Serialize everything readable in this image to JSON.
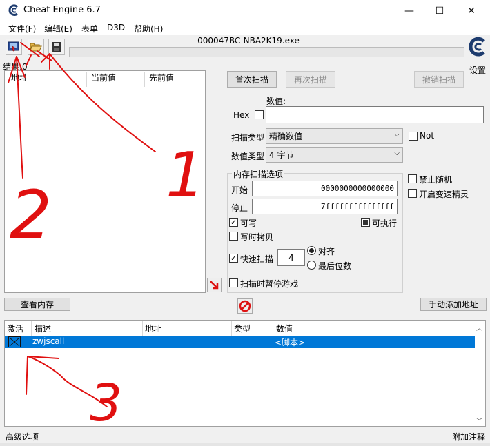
{
  "window": {
    "title": "Cheat Engine 6.7",
    "minimize": "—",
    "maximize": "☐",
    "close": "✕"
  },
  "menu": [
    "文件(F)",
    "编辑(E)",
    "表单",
    "D3D",
    "帮助(H)"
  ],
  "toolbar": {
    "process_name": "000047BC-NBA2K19.exe",
    "settings_label": "设置",
    "icons": [
      "select-process-icon",
      "open-folder-icon",
      "save-disk-icon"
    ]
  },
  "results": {
    "label": "结果:0",
    "columns": [
      "地址",
      "当前值",
      "先前值"
    ]
  },
  "scan": {
    "first_scan": "首次扫描",
    "next_scan": "再次扫描",
    "undo_scan": "撤销扫描",
    "value_label": "数值:",
    "hex_label": "Hex",
    "value": "",
    "scan_type_label": "扫描类型",
    "scan_type_value": "精确数值",
    "not_label": "Not",
    "value_type_label": "数值类型",
    "value_type_value": "4 字节"
  },
  "memory_options": {
    "title": "内存扫描选项",
    "start_label": "开始",
    "start_value": "0000000000000000",
    "stop_label": "停止",
    "stop_value": "7fffffffffffffff",
    "writable_label": "可写",
    "writable": true,
    "executable_label": "可执行",
    "copy_on_write_label": "写时拷贝",
    "fast_scan_label": "快速扫描",
    "fast_scan_value": "4",
    "align_label": "对齐",
    "last_digits_label": "最后位数",
    "pause_label": "扫描时暂停游戏"
  },
  "side_options": {
    "no_random_label": "禁止随机",
    "speedhack_label": "开启变速精灵"
  },
  "buttons": {
    "view_memory": "查看内存",
    "add_address": "手动添加地址"
  },
  "address_list": {
    "columns": [
      "激活",
      "描述",
      "地址",
      "类型",
      "数值"
    ],
    "rows": [
      {
        "active": true,
        "description": "zwjscall",
        "address": "",
        "type": "",
        "value": "<脚本>"
      }
    ]
  },
  "status": {
    "advanced": "高级选项",
    "annotations": "附加注释"
  },
  "annotations": [
    "1",
    "2",
    "3"
  ],
  "colors": {
    "selection": "#0078d7",
    "annotation": "#e01010"
  }
}
